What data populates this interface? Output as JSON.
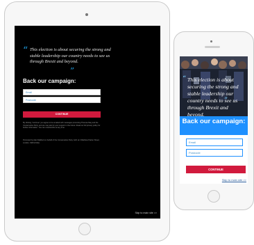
{
  "campaign": {
    "quote": "This election is about securing the strong and stable leadership our country needs to see us through Brexit and beyond.",
    "quote_open": "“",
    "quote_close": "”",
    "heading": "Back our campaign:",
    "email_placeholder": "Email",
    "postcode_placeholder": "Postcode",
    "continue_label": "CONTINUE",
    "skip_label": "Skip to main site >>"
  },
  "tablet": {
    "disclaimer": "By clicking \"continue\" you agree to be emailed with messages promoting Theresa May and the Conservative Party, and we may ask for your support in the future. Read our full privacy policy for further information. You can unsubscribe at any time.",
    "promoted_by": "Promoted by Alan Mabbutt on behalf of the Conservative Party, both at 4 Matthew Parker Street, London, SW1H 9HQ."
  },
  "colors": {
    "tablet_bg": "#000000",
    "accent_blue": "#1e90ff",
    "button_red": "#d11a3d",
    "quote_blue": "#1f9ce0"
  }
}
